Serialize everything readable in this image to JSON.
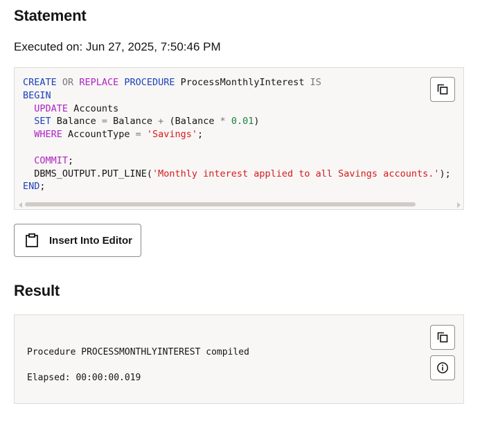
{
  "statement": {
    "heading": "Statement",
    "executed_label": "Executed on: Jun 27, 2025, 7:50:46 PM",
    "code": {
      "l1": {
        "create": "CREATE",
        "or": "OR",
        "replace": "REPLACE",
        "procedure": "PROCEDURE",
        "name": "ProcessMonthlyInterest",
        "is": "IS"
      },
      "l2": {
        "begin": "BEGIN"
      },
      "l3": {
        "update": "UPDATE",
        "table": "Accounts"
      },
      "l4": {
        "set": "SET",
        "lhs": "Balance",
        "eq": "=",
        "a": "Balance",
        "plus": "+",
        "b": "(Balance",
        "mul": "*",
        "num": "0.01",
        "close": ")"
      },
      "l5": {
        "where": "WHERE",
        "col": "AccountType",
        "eq": "=",
        "str": "'Savings'",
        "semi": ";"
      },
      "l7": {
        "commit": "COMMIT",
        "semi": ";"
      },
      "l8": {
        "call": "DBMS_OUTPUT.PUT_LINE(",
        "str": "'Monthly interest applied to all Savings accounts.'",
        "end": ");"
      },
      "l9": {
        "end": "END",
        "semi": ";"
      }
    },
    "copy_icon": "copy-icon",
    "insert_button_label": "Insert Into Editor",
    "insert_icon": "clipboard-icon"
  },
  "result": {
    "heading": "Result",
    "line1": "Procedure PROCESSMONTHLYINTEREST compiled",
    "line2": "Elapsed: 00:00:00.019",
    "copy_icon": "copy-icon",
    "info_icon": "info-icon"
  }
}
